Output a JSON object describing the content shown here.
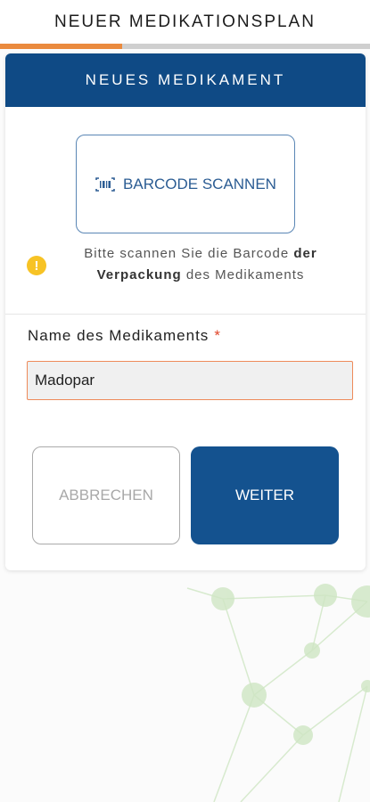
{
  "header": {
    "title": "NEUER MEDIKATIONSPLAN",
    "progress": 0.33,
    "progress_color": "#ea8a3e"
  },
  "card": {
    "title": "NEUES MEDIKAMENT",
    "header_color": "#0f4a85",
    "scan_button": {
      "label": "BARCODE SCANNEN",
      "icon": "barcode-icon"
    },
    "hint": {
      "icon": "warning-icon",
      "text_1": "Bitte scannen Sie die Barcode ",
      "bold_1": "der Verpackung",
      "text_2": " des Medikaments"
    },
    "field": {
      "label": "Name des Medikaments",
      "required_mark": "*",
      "value": "Madopar"
    },
    "cancel_label": "ABBRECHEN",
    "next_label": "WEITER"
  }
}
